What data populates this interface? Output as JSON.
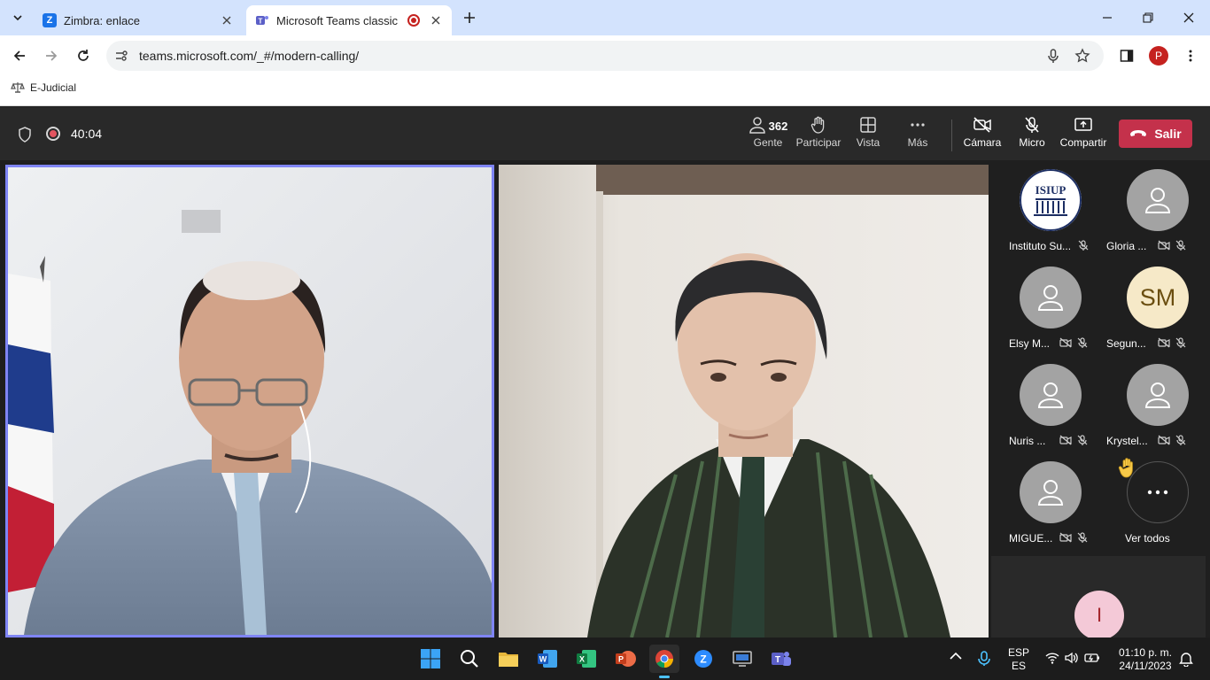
{
  "browser": {
    "tabs": [
      {
        "title": "Zimbra: enlace",
        "favicon": "zimbra-icon"
      },
      {
        "title": "Microsoft Teams classic",
        "favicon": "teams-icon"
      }
    ],
    "url": "teams.microsoft.com/_#/modern-calling/",
    "profile_initial": "P",
    "bookmark": "E-Judicial"
  },
  "call": {
    "duration": "40:04",
    "people_count": "362",
    "controls": {
      "people": "Gente",
      "raise": "Participar",
      "view": "Vista",
      "more": "Más",
      "camera": "Cámara",
      "mic": "Micro",
      "share": "Compartir",
      "leave": "Salir"
    }
  },
  "roster": [
    {
      "name": "Instituto Su...",
      "avatar": "logo",
      "logo_text": "ISIUP"
    },
    {
      "name": "Gloria ...",
      "avatar": "person-icon"
    },
    {
      "name": "Elsy M...",
      "avatar": "person-icon"
    },
    {
      "name": "Segun...",
      "avatar": "initials",
      "initials": "SM"
    },
    {
      "name": "Nuris ...",
      "avatar": "person-icon"
    },
    {
      "name": "Krystel...",
      "avatar": "person-icon"
    },
    {
      "name": "MIGUE...",
      "avatar": "person-icon"
    }
  ],
  "see_all": "Ver todos",
  "bottom_avatar": "I",
  "taskbar": {
    "lang_top": "ESP",
    "lang_bottom": "ES",
    "time": "01:10 p. m.",
    "date": "24/11/2023"
  },
  "colors": {
    "leave": "#c4314b",
    "active_speaker": "#7f85f5",
    "teams": "#5b5fc7"
  }
}
